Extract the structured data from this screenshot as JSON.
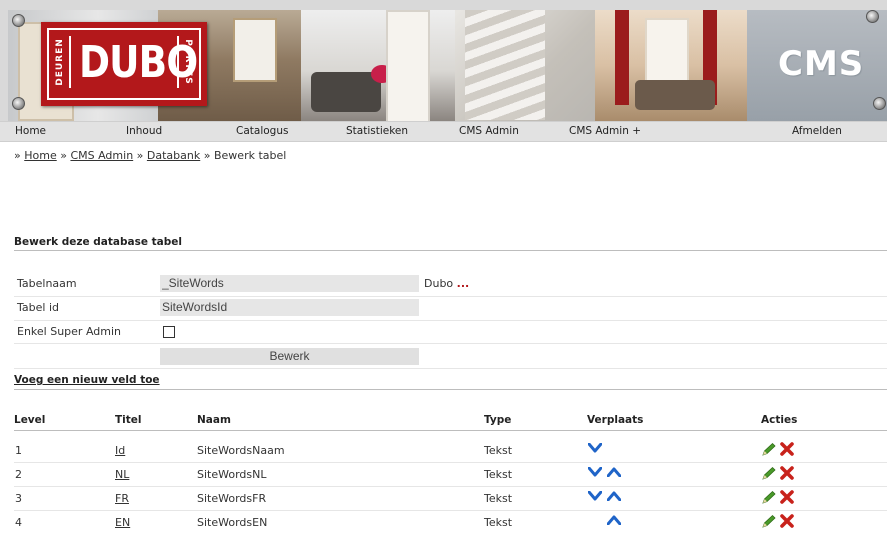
{
  "header": {
    "logo_brand": "DUBO",
    "logo_left": "DEUREN",
    "logo_right": "PORTES",
    "app_mark": "CMS"
  },
  "nav": {
    "items": [
      "Home",
      "Inhoud",
      "Catalogus",
      "Statistieken",
      "CMS Admin",
      "CMS Admin +",
      "Afmelden"
    ]
  },
  "breadcrumb": {
    "separator": "»",
    "home": "Home",
    "cms_admin": "CMS Admin",
    "databank": "Databank",
    "current": "Bewerk tabel"
  },
  "form": {
    "title": "Bewerk deze database tabel",
    "table_name_label": "Tabelnaam",
    "table_name_value": "_SiteWords",
    "table_name_suffix": "Dubo",
    "table_name_more": "...",
    "table_id_label": "Tabel id",
    "table_id_value": "SiteWordsId",
    "super_admin_label": "Enkel Super Admin",
    "super_admin_checked": false,
    "submit_label": "Bewerk"
  },
  "add_field_link": "Voeg een nieuw veld toe",
  "table": {
    "headers": {
      "level": "Level",
      "title": "Titel",
      "name": "Naam",
      "type": "Type",
      "move": "Verplaats",
      "actions": "Acties"
    },
    "rows": [
      {
        "level": "1",
        "title": "Id",
        "name": "SiteWordsNaam",
        "type": "Tekst",
        "can_down": true,
        "can_up": false
      },
      {
        "level": "2",
        "title": "NL",
        "name": "SiteWordsNL",
        "type": "Tekst",
        "can_down": true,
        "can_up": true
      },
      {
        "level": "3",
        "title": "FR",
        "name": "SiteWordsFR",
        "type": "Tekst",
        "can_down": true,
        "can_up": true
      },
      {
        "level": "4",
        "title": "EN",
        "name": "SiteWordsEN",
        "type": "Tekst",
        "can_down": false,
        "can_up": true
      }
    ]
  },
  "colors": {
    "brand_red": "#b3181b",
    "move_arrow": "#1f64c8",
    "edit_green": "#4a9a2a",
    "delete_red": "#c8221b"
  },
  "icons": {
    "move_down": "chevron-down-icon",
    "move_up": "chevron-up-icon",
    "edit": "pencil-icon",
    "delete": "delete-x-icon"
  }
}
